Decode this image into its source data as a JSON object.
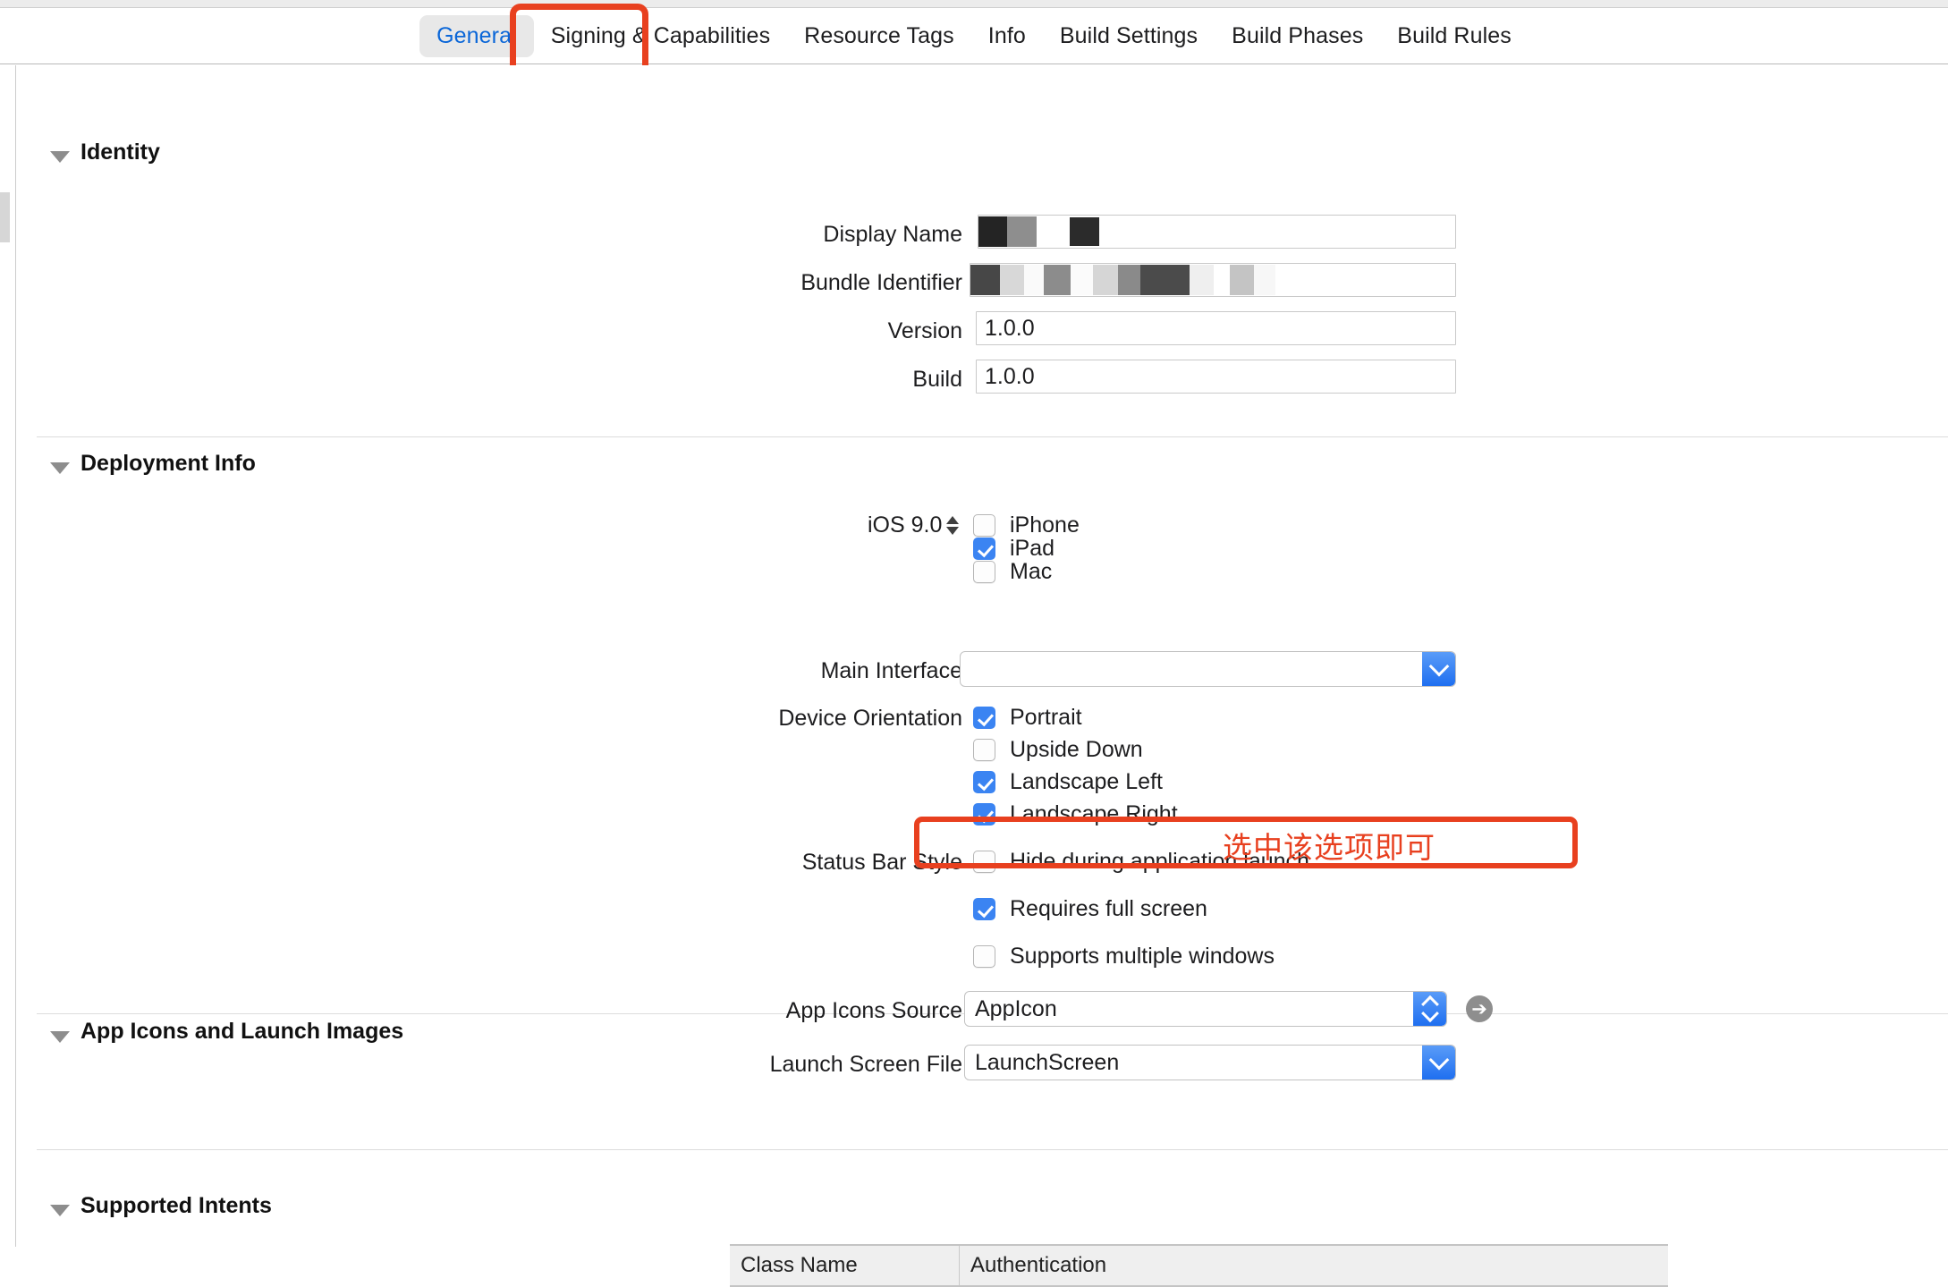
{
  "window": {
    "tabs": [
      {
        "label": "General",
        "active": true
      },
      {
        "label": "Signing & Capabilities",
        "active": false
      },
      {
        "label": "Resource Tags",
        "active": false
      },
      {
        "label": "Info",
        "active": false
      },
      {
        "label": "Build Settings",
        "active": false
      },
      {
        "label": "Build Phases",
        "active": false
      },
      {
        "label": "Build Rules",
        "active": false
      }
    ]
  },
  "accent": {
    "tab_active_text": "#0a66d8",
    "checkbox_on": "#3b84f2",
    "annotation_red": "#e8401f",
    "popup_blue": "#1f6ff0"
  },
  "identity": {
    "title": "Identity",
    "display_name_label": "Display Name",
    "display_name_value": "",
    "bundle_identifier_label": "Bundle Identifier",
    "bundle_identifier_value": "",
    "version_label": "Version",
    "version_value": "1.0.0",
    "build_label": "Build",
    "build_value": "1.0.0"
  },
  "deployment": {
    "title": "Deployment Info",
    "target_label": "iOS 9.0",
    "devices": [
      {
        "label": "iPhone",
        "checked": false
      },
      {
        "label": "iPad",
        "checked": true
      },
      {
        "label": "Mac",
        "checked": false
      }
    ],
    "main_interface_label": "Main Interface",
    "main_interface_value": "",
    "device_orientation_label": "Device Orientation",
    "orientations": [
      {
        "label": "Portrait",
        "checked": true
      },
      {
        "label": "Upside Down",
        "checked": false
      },
      {
        "label": "Landscape Left",
        "checked": true
      },
      {
        "label": "Landscape Right",
        "checked": true
      }
    ],
    "status_bar_style_label": "Status Bar Style",
    "status_options": [
      {
        "label": "Hide during application launch",
        "checked": false
      },
      {
        "label": "Requires full screen",
        "checked": true
      },
      {
        "label": "Supports multiple windows",
        "checked": false
      }
    ]
  },
  "app_icons": {
    "title": "App Icons and Launch Images",
    "app_icons_source_label": "App Icons Source",
    "app_icons_source_value": "AppIcon",
    "launch_screen_label": "Launch Screen File",
    "launch_screen_value": "LaunchScreen",
    "goto_arrow": "➔"
  },
  "supported_intents": {
    "title": "Supported Intents",
    "columns": [
      "Class Name",
      "Authentication"
    ]
  },
  "annotation": {
    "text": "选中该选项即可"
  }
}
